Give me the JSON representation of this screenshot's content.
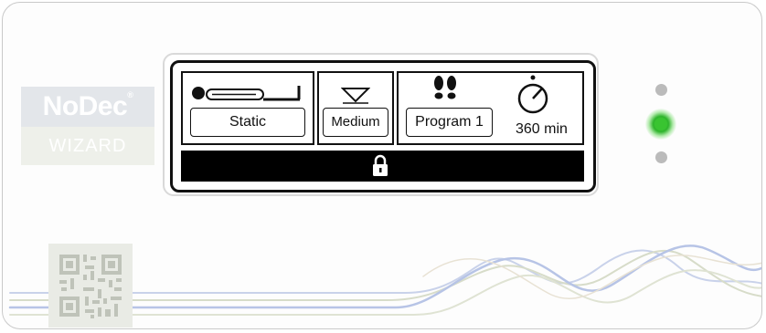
{
  "brand": {
    "name": "NoDec",
    "registered_mark": "®",
    "model": "WIZARD"
  },
  "display": {
    "mode_label": "Static",
    "level_label": "Medium",
    "program_label": "Program 1",
    "timer_label": "360 min",
    "icons": {
      "mode": "mattress-icon",
      "level": "triangle-down-icon",
      "program": "footprints-icon",
      "timer": "stopwatch-icon",
      "lock": "lock-icon"
    }
  },
  "status_leds": {
    "top": "off",
    "middle": "on",
    "bottom": "off",
    "active_color": "#39c431"
  }
}
